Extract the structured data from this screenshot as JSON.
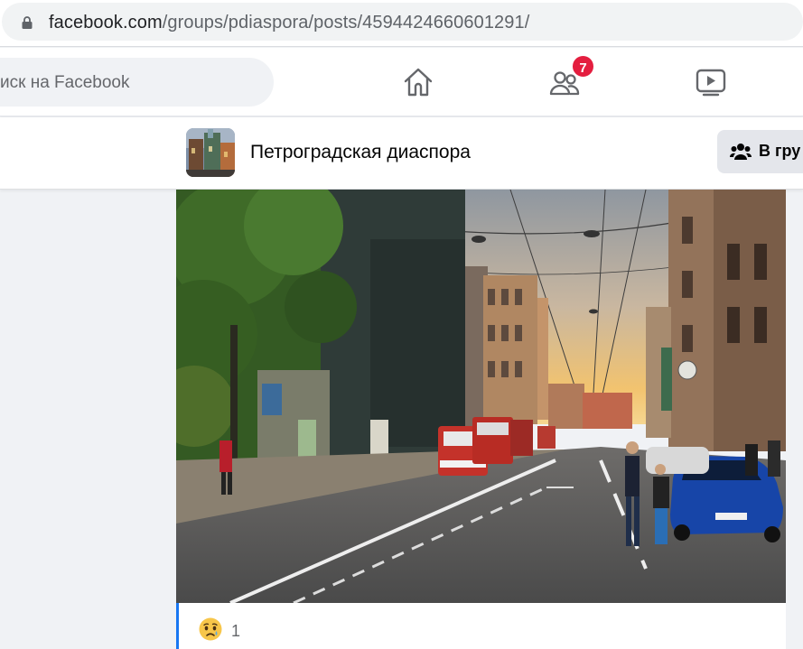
{
  "browser": {
    "url_host": "facebook.com",
    "url_path": "/groups/pdiaspora/posts/4594424660601291/"
  },
  "nav": {
    "search_placeholder": "иск на Facebook",
    "friends_badge": "7"
  },
  "group": {
    "name": "Петроградская диаспора",
    "join_button_label": "В гру"
  },
  "post": {
    "reaction_icon": "sad-emoji-icon",
    "reaction_count": "1"
  },
  "colors": {
    "accent": "#1877f2",
    "badge": "#e41e3f"
  }
}
